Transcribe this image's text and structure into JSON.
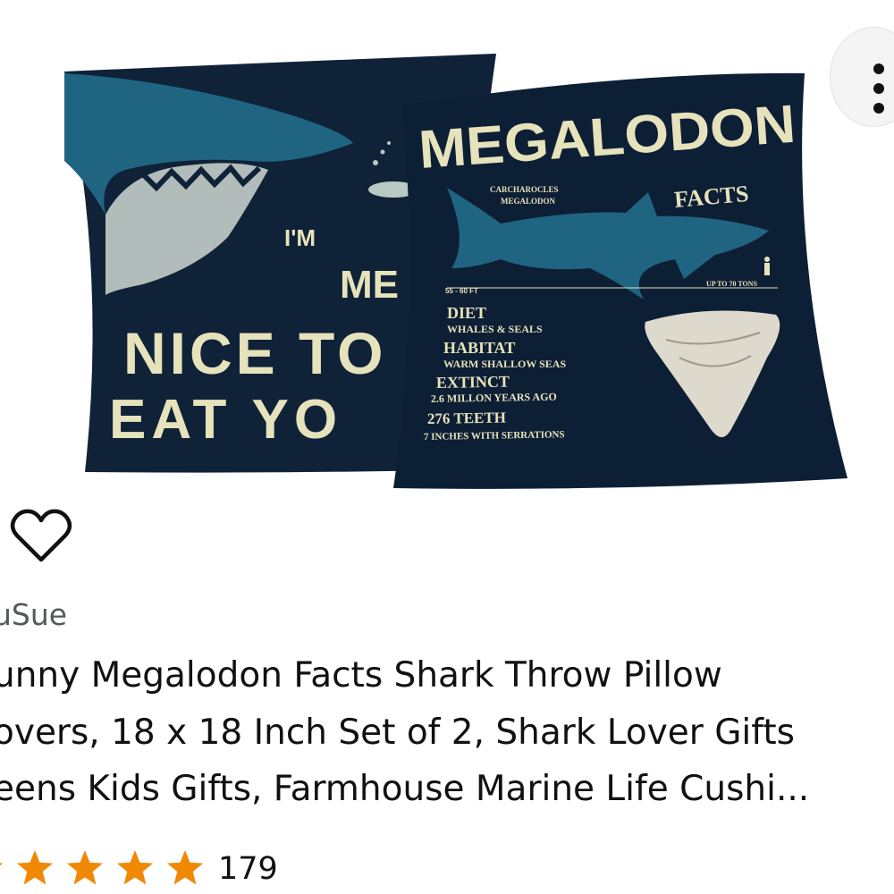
{
  "product": {
    "brand": "uSue",
    "title_lines": [
      "unny Megalodon Facts Shark Throw Pillow",
      "overs, 18 x 18 Inch Set of 2, Shark Lover Gifts",
      "eens Kids Gifts, Farmhouse Marine Life Cushi..."
    ],
    "rating": 5,
    "review_count": "179"
  },
  "image": {
    "left_pillow": {
      "line1": "I'M",
      "line2": "ME",
      "line3": "NICE TO",
      "line4": "EAT YO"
    },
    "right_pillow": {
      "title": "MEGALODON",
      "subtitle": "FACTS",
      "species_line1": "CARCHAROCLES",
      "species_line2": "MEGALODON",
      "length": "55 - 60 FT",
      "weight": "UP TO 70 TONS",
      "facts": [
        {
          "heading": "DIET",
          "detail": "WHALES & SEALS"
        },
        {
          "heading": "HABITAT",
          "detail": "WARM SHALLOW SEAS"
        },
        {
          "heading": "EXTINCT",
          "detail": "2.6 MILLON YEARS AGO"
        },
        {
          "heading": "276 TEETH",
          "detail": "7 INCHES WITH SERRATIONS"
        }
      ]
    }
  },
  "icons": {
    "more": "more-vertical-icon",
    "wishlist": "heart-outline-icon",
    "star": "star-icon"
  },
  "colors": {
    "pillow_navy": "#0f2238",
    "shark_teal": "#1f6582",
    "print_cream": "#e6e2bb",
    "star_orange": "#f08804"
  }
}
